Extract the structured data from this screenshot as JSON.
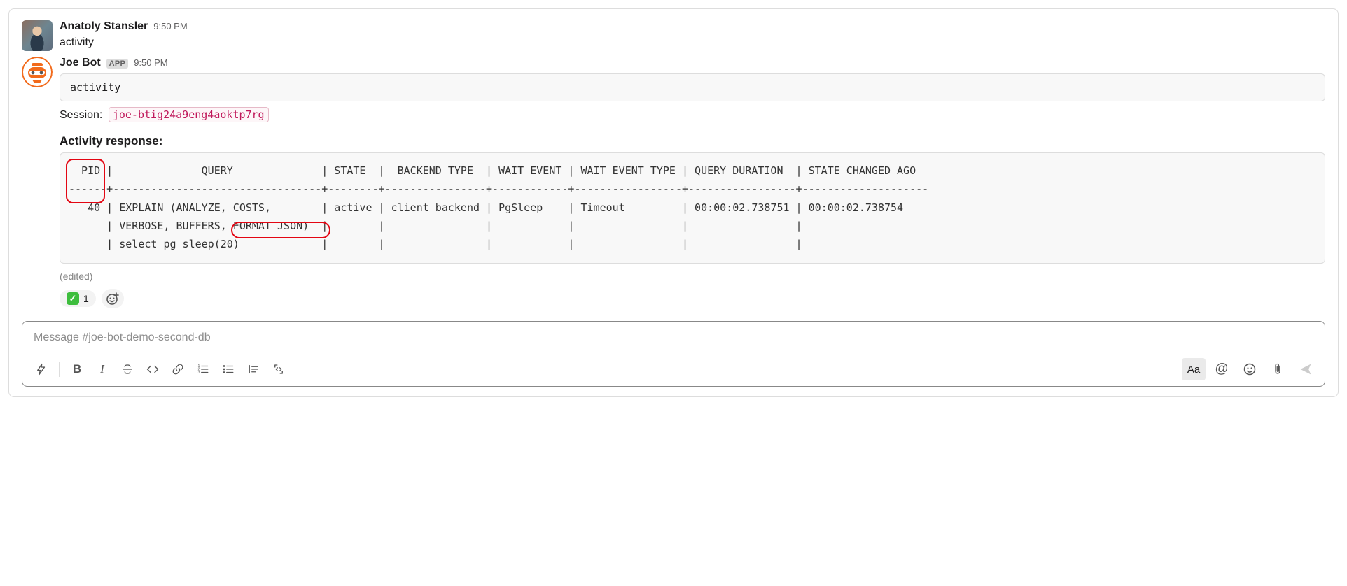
{
  "messages": {
    "user": {
      "name": "Anatoly Stansler",
      "time": "9:50 PM",
      "text": "activity"
    },
    "bot": {
      "name": "Joe Bot",
      "badge": "APP",
      "time": "9:50 PM",
      "code_block": "activity",
      "session_label": "Session:",
      "session_token": "joe-btig24a9eng4aoktp7rg",
      "section_title": "Activity response:",
      "table_text": "  PID |              QUERY              | STATE  |  BACKEND TYPE  | WAIT EVENT | WAIT EVENT TYPE | QUERY DURATION  | STATE CHANGED AGO  \n------+---------------------------------+--------+----------------+------------+-----------------+-----------------+--------------------\n   40 | EXPLAIN (ANALYZE, COSTS,        | active | client backend | PgSleep    | Timeout         | 00:00:02.738751 | 00:00:02.738754    \n      | VERBOSE, BUFFERS, FORMAT JSON)  |        |                |            |                 |                 |                    \n      | select pg_sleep(20)             |        |                |            |                 |                 |                    ",
      "edited_label": "(edited)",
      "reaction_count": "1"
    }
  },
  "composer": {
    "placeholder": "Message #joe-bot-demo-second-db"
  }
}
